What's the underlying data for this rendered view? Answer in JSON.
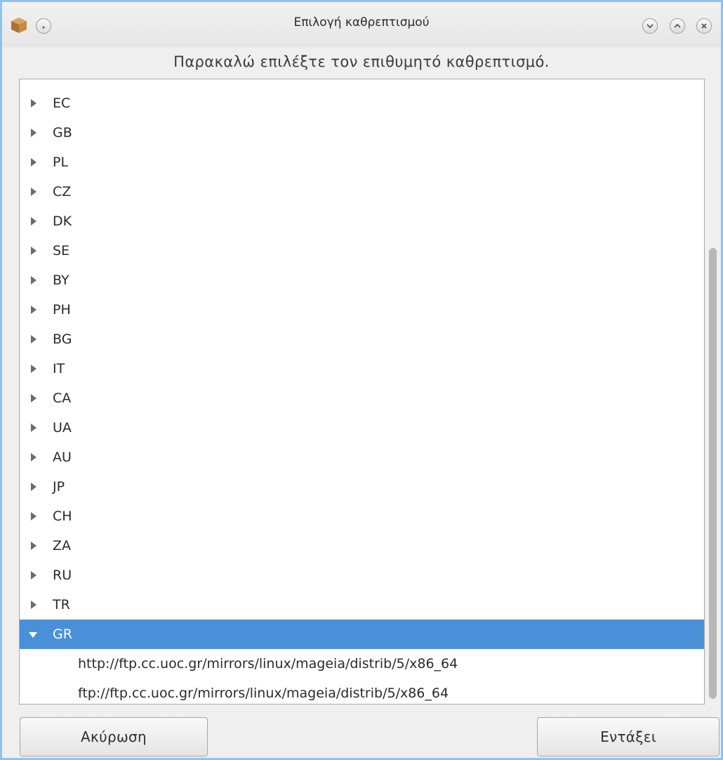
{
  "window": {
    "title": "Επιλογή καθρεπτισμού",
    "icons": {
      "app": "package-box-icon",
      "menu": "window-menu-icon",
      "minimize": "chevron-down-icon",
      "maximize": "chevron-up-icon",
      "close": "close-icon"
    }
  },
  "instruction": "Παρακαλώ επιλέξτε τον επιθυμητό καθρεπτισμό.",
  "tree": {
    "countries": [
      "EC",
      "GB",
      "PL",
      "CZ",
      "DK",
      "SE",
      "BY",
      "PH",
      "BG",
      "IT",
      "CA",
      "UA",
      "AU",
      "JP",
      "CH",
      "ZA",
      "RU",
      "TR"
    ],
    "expanded": {
      "country": "GR",
      "mirrors": [
        "http://ftp.cc.uoc.gr/mirrors/linux/mageia/distrib/5/x86_64",
        "ftp://ftp.cc.uoc.gr/mirrors/linux/mageia/distrib/5/x86_64"
      ]
    }
  },
  "buttons": {
    "cancel": "Ακύρωση",
    "ok": "Εντάξει"
  },
  "colors": {
    "selection": "#4a90d9",
    "window_border": "#8fc2ec"
  }
}
